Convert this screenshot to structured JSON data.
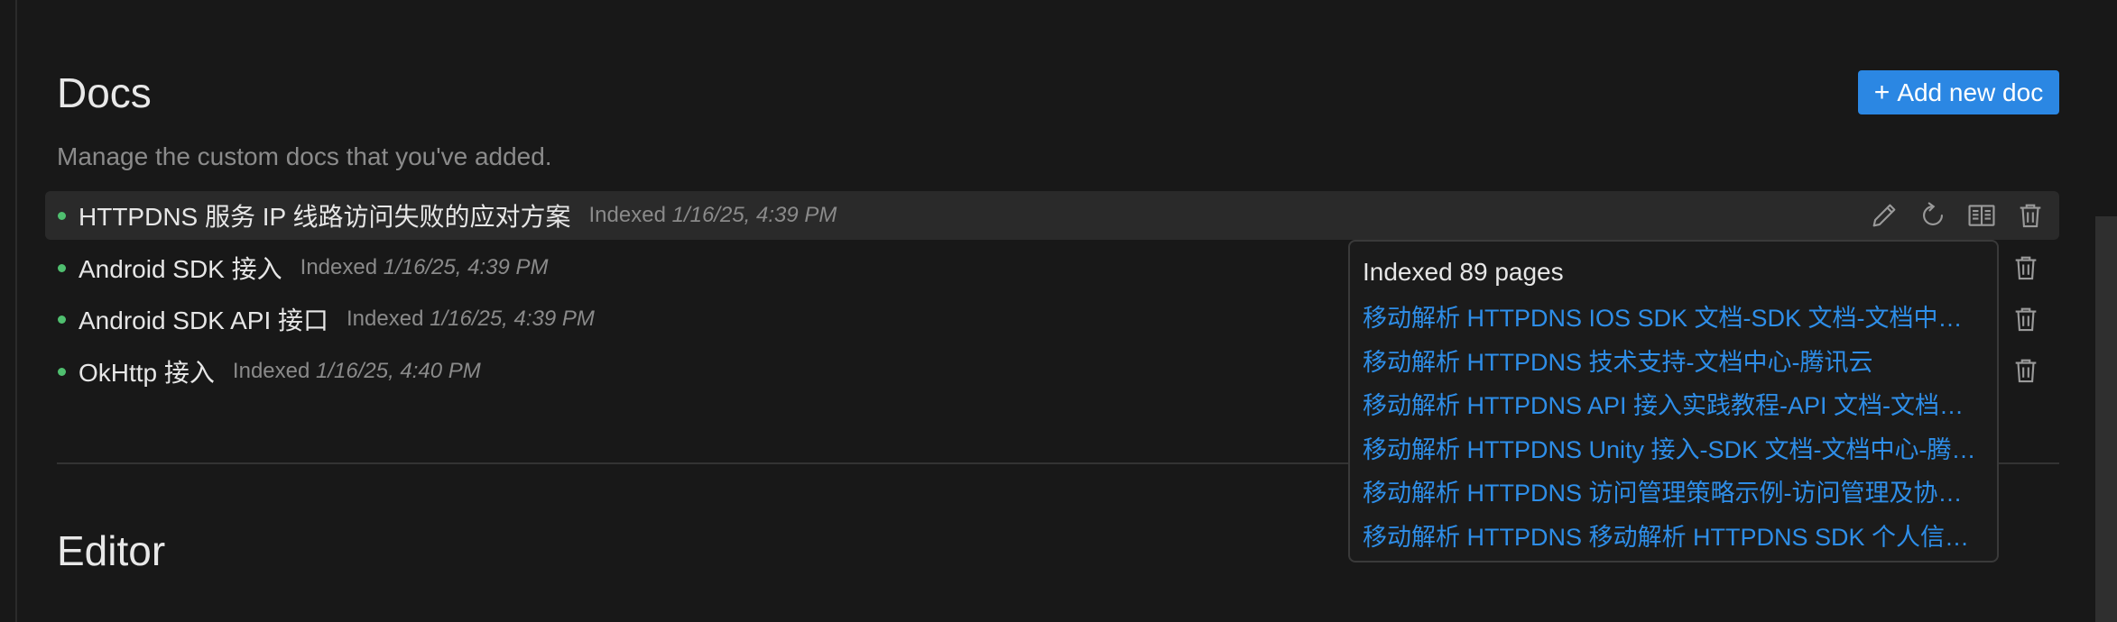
{
  "docs": {
    "title": "Docs",
    "subtitle": "Manage the custom docs that you've added.",
    "add_button_label": "Add new doc",
    "items": [
      {
        "name": "HTTPDNS 服务 IP 线路访问失败的应对方案",
        "status_label": "Indexed",
        "timestamp": "1/16/25, 4:39 PM"
      },
      {
        "name": "Android SDK 接入",
        "status_label": "Indexed",
        "timestamp": "1/16/25, 4:39 PM"
      },
      {
        "name": "Android SDK API 接口",
        "status_label": "Indexed",
        "timestamp": "1/16/25, 4:39 PM"
      },
      {
        "name": "OkHttp 接入",
        "status_label": "Indexed",
        "timestamp": "1/16/25, 4:40 PM"
      }
    ],
    "icons": {
      "edit": "pencil-icon",
      "reindex": "refresh-icon",
      "view": "book-icon",
      "delete": "trash-icon",
      "add": "plus-icon"
    },
    "status_color": "#4fbf6f"
  },
  "popover": {
    "title": "Indexed 89 pages",
    "links": [
      "移动解析 HTTPDNS IOS SDK 文档-SDK 文档-文档中心-腾讯云",
      "移动解析 HTTPDNS 技术支持-文档中心-腾讯云",
      "移动解析 HTTPDNS API 接入实践教程-API 文档-文档中心-腾讯云",
      "移动解析 HTTPDNS Unity 接入-SDK 文档-文档中心-腾讯云",
      "移动解析 HTTPDNS 访问管理策略示例-访问管理及协作-文档中心-腾讯云",
      "移动解析 HTTPDNS 移动解析 HTTPDNS SDK 个人信息保护规则-文档中心-腾讯云"
    ]
  },
  "editor": {
    "title": "Editor"
  },
  "colors": {
    "accent": "#2b87e3",
    "link": "#2e8ee8",
    "background": "#181818"
  }
}
